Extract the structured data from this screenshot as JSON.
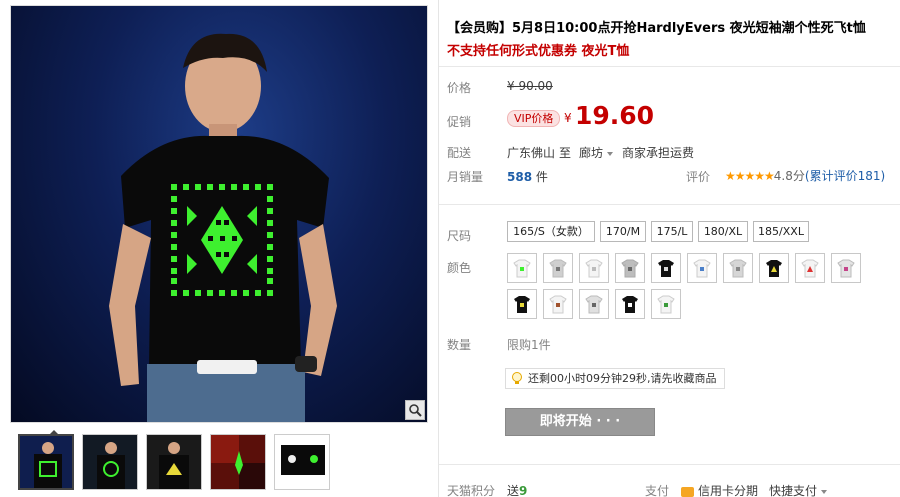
{
  "product": {
    "title": "【会员购】5月8日10:00点开抢HardlyEvers 夜光短袖潮个性死飞t恤",
    "subtitle": "不支持任何形式优惠券 夜光T恤"
  },
  "price": {
    "original_label": "价格",
    "original_value": "¥ 90.00",
    "promo_label": "促销",
    "vip_badge": "VIP价格",
    "currency": "¥",
    "promo_value": "19.60"
  },
  "shipping": {
    "label": "配送",
    "from": "广东佛山",
    "to_word": "至",
    "destination": "廊坊",
    "fee_note": "商家承担运费"
  },
  "sales": {
    "label": "月销量",
    "count": "588",
    "unit": "件",
    "review_label": "评价",
    "stars": "★★★★★",
    "score": "4.8分",
    "review_count": "(累计评价181)"
  },
  "sizes": {
    "label": "尺码",
    "options": [
      "165/S（女款）",
      "170/M",
      "175/L",
      "180/XL",
      "185/XXL"
    ]
  },
  "colors": {
    "label": "颜色"
  },
  "quantity": {
    "label": "数量",
    "limit": "限购1件"
  },
  "countdown": {
    "text": "还剩00小时09分钟29秒,请先收藏商品"
  },
  "actions": {
    "start_button": "即将开始 · · ·"
  },
  "footer": {
    "points_label": "天猫积分",
    "points_prefix": "送",
    "points_value": "9",
    "pay_label": "支付",
    "credit_card": "信用卡分期",
    "fast_pay": "快捷支付"
  },
  "colors_theme": {
    "price_red": "#c40000",
    "link_blue": "#1f5ea8",
    "star_orange": "#ff9900",
    "button_gray": "#9a9a9a"
  }
}
